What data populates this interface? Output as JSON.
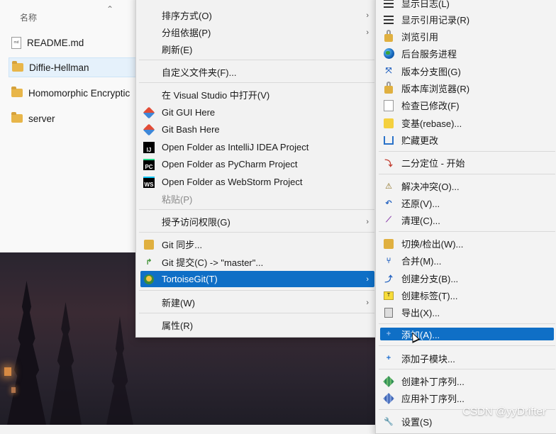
{
  "explorer": {
    "column_header": "名称",
    "sort_icon": "chevron-up-icon",
    "files": [
      {
        "name": "README.md",
        "type": "file",
        "icon": "markdown-file-icon"
      },
      {
        "name": "Diffie-Hellman",
        "type": "folder",
        "icon": "folder-icon",
        "selected": true
      },
      {
        "name": "Homomorphic Encryptic",
        "type": "folder",
        "icon": "folder-icon"
      },
      {
        "name": "server",
        "type": "folder",
        "icon": "folder-icon"
      }
    ]
  },
  "context_menu": {
    "items": [
      {
        "label": "排序方式(O)",
        "submenu": true
      },
      {
        "label": "分组依据(P)",
        "submenu": true
      },
      {
        "label": "刷新(E)"
      },
      {
        "label": "自定义文件夹(F)..."
      },
      {
        "label": "在 Visual Studio 中打开(V)"
      },
      {
        "label": "Git GUI Here",
        "icon": "git-icon"
      },
      {
        "label": "Git Bash Here",
        "icon": "git-icon"
      },
      {
        "label": "Open Folder as IntelliJ IDEA Project",
        "icon": "intellij-icon",
        "icon_text": "IJ"
      },
      {
        "label": "Open Folder as PyCharm Project",
        "icon": "pycharm-icon",
        "icon_text": "PC"
      },
      {
        "label": "Open Folder as WebStorm Project",
        "icon": "webstorm-icon",
        "icon_text": "WS"
      },
      {
        "label": "粘贴(P)",
        "disabled": true
      },
      {
        "label": "授予访问权限(G)",
        "submenu": true
      },
      {
        "label": "Git 同步...",
        "icon": "tortoise-sync-icon"
      },
      {
        "label": "Git 提交(C) -> \"master\"...",
        "icon": "tortoise-commit-icon"
      },
      {
        "label": "TortoiseGit(T)",
        "icon": "tortoisegit-icon",
        "submenu": true,
        "highlighted": true
      },
      {
        "label": "新建(W)",
        "submenu": true
      },
      {
        "label": "属性(R)"
      }
    ]
  },
  "tortoise_submenu": {
    "items": [
      {
        "label": "显示日志(L)",
        "icon": "log-icon"
      },
      {
        "label": "显示引用记录(R)",
        "icon": "reflog-icon"
      },
      {
        "label": "浏览引用",
        "icon": "browse-refs-icon"
      },
      {
        "label": "后台服务进程",
        "icon": "daemon-globe-icon"
      },
      {
        "label": "版本分支图(G)",
        "icon": "revision-graph-icon"
      },
      {
        "label": "版本库浏览器(R)",
        "icon": "repo-browser-icon"
      },
      {
        "label": "检查已修改(F)",
        "icon": "check-modifications-icon"
      },
      {
        "label": "变基(rebase)...",
        "icon": "rebase-icon"
      },
      {
        "label": "贮藏更改",
        "icon": "stash-icon"
      },
      {
        "label": "二分定位 - 开始",
        "icon": "bisect-icon"
      },
      {
        "label": "解决冲突(O)...",
        "icon": "resolve-icon"
      },
      {
        "label": "还原(V)...",
        "icon": "revert-icon"
      },
      {
        "label": "清理(C)...",
        "icon": "cleanup-icon"
      },
      {
        "label": "切换/检出(W)...",
        "icon": "switch-icon"
      },
      {
        "label": "合并(M)...",
        "icon": "merge-icon"
      },
      {
        "label": "创建分支(B)...",
        "icon": "create-branch-icon"
      },
      {
        "label": "创建标签(T)...",
        "icon": "tag-icon"
      },
      {
        "label": "导出(X)...",
        "icon": "export-icon"
      },
      {
        "label": "添加(A)...",
        "icon": "add-icon",
        "highlighted": true
      },
      {
        "label": "添加子模块...",
        "icon": "add-submodule-icon"
      },
      {
        "label": "创建补丁序列...",
        "icon": "create-patch-icon"
      },
      {
        "label": "应用补丁序列...",
        "icon": "apply-patch-icon"
      },
      {
        "label": "设置(S)",
        "icon": "settings-icon"
      }
    ]
  },
  "watermark": "CSDN @yyDrifter",
  "colors": {
    "highlight": "#0f6fc6",
    "menu_bg": "#f2f2f2",
    "folder": "#e8b64a"
  }
}
